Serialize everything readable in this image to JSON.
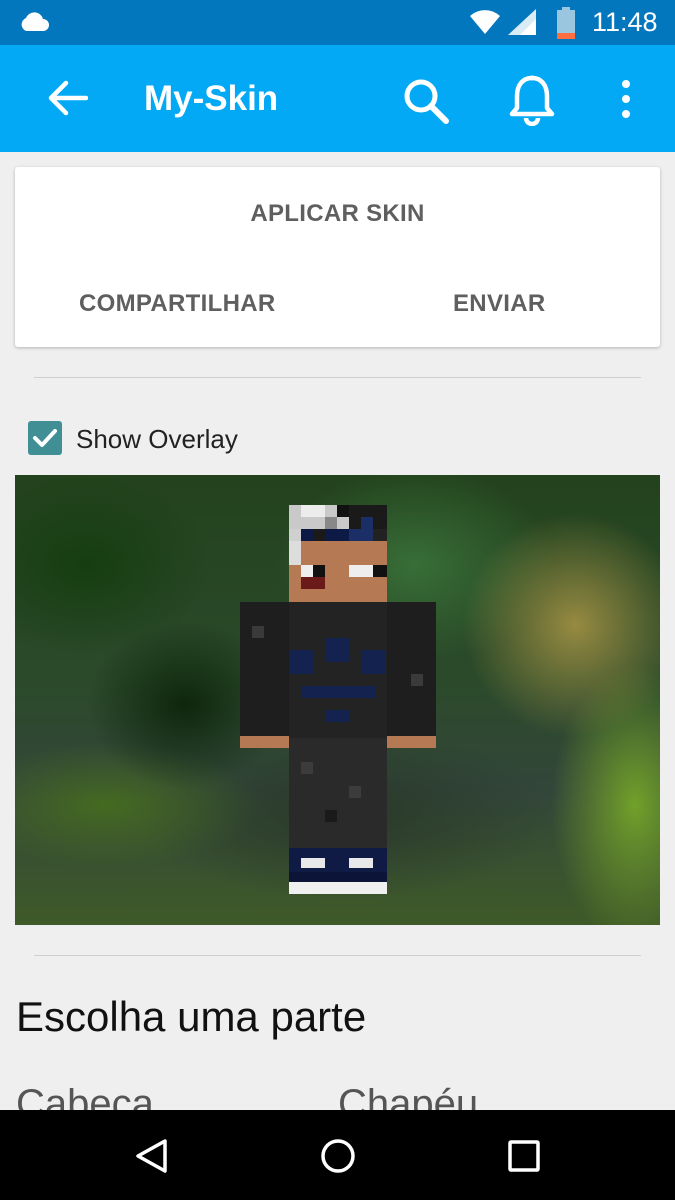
{
  "status_bar": {
    "time": "11:48",
    "icons": [
      "cloud-icon",
      "wifi-icon",
      "signal-icon",
      "battery-icon"
    ]
  },
  "app_bar": {
    "title": "My-Skin",
    "icons": [
      "back-arrow-icon",
      "search-icon",
      "bell-icon",
      "more-vert-icon"
    ],
    "color": "#03a9f4"
  },
  "actions": {
    "apply": "APLICAR SKIN",
    "share": "COMPARTILHAR",
    "send": "ENVIAR"
  },
  "overlay": {
    "label": "Show Overlay",
    "checked": true,
    "color": "#3f8f95"
  },
  "section": {
    "title": "Escolha uma parte"
  },
  "parts": [
    "Cabeça",
    "Chapéu"
  ],
  "nav_bar": {
    "icons": [
      "nav-back-icon",
      "nav-home-icon",
      "nav-recents-icon"
    ]
  }
}
